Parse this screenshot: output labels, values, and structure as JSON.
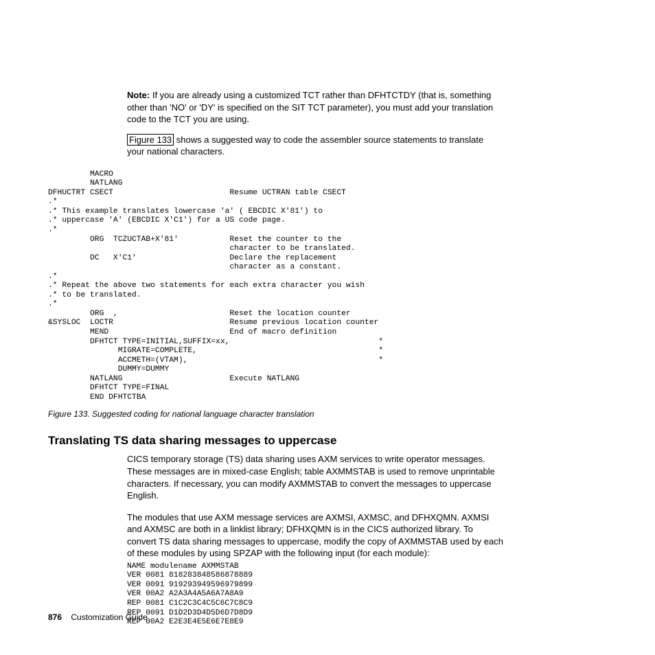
{
  "note": {
    "label": "Note:",
    "text": "If you are already using a customized TCT rather than DFHTCTDY (that is, something other than 'NO' or 'DY' is specified on the SIT TCT parameter), you must add your translation code to the TCT you are using."
  },
  "para1_ref": "Figure 133",
  "para1_rest": " shows a suggested way to code the assembler source statements to translate your national characters.",
  "code1": "         MACRO\n         NATLANG\nDFHUCTRT CSECT                         Resume UCTRAN table CSECT\n.*\n.* This example translates lowercase 'a' ( EBCDIC X'81') to\n.* uppercase 'A' (EBCDIC X'C1') for a US code page.\n.*\n         ORG  TCZUCTAB+X'81'           Reset the counter to the\n                                       character to be translated.\n         DC   X'C1'                    Declare the replacement\n                                       character as a constant.\n.*\n.* Repeat the above two statements for each extra character you wish\n.* to be translated.\n.*\n         ORG  ,                        Reset the location counter\n&SYSLOC  LOCTR                         Resume previous location counter\n         MEND                          End of macro definition\n         DFHTCT TYPE=INITIAL,SUFFIX=xx,                                *\n               MIGRATE=COMPLETE,                                       *\n               ACCMETH=(VTAM),                                         *\n               DUMMY=DUMMY\n         NATLANG                       Execute NATLANG\n         DFHTCT TYPE=FINAL\n         END DFHTCTBA",
  "figcap": "Figure 133. Suggested coding for national language character translation",
  "h2": "Translating TS data sharing messages to uppercase",
  "body1": "CICS temporary storage (TS) data sharing uses AXM services to write operator messages. These messages are in mixed-case English; table AXMMSTAB is used to remove unprintable characters. If necessary, you can modify AXMMSTAB to convert the messages to uppercase English.",
  "body2": "The modules that use AXM message services are AXMSI, AXMSC, and DFHXQMN. AXMSI and AXMSC are both in a linklist library; DFHXQMN is in the CICS authorized library. To convert TS data sharing messages to uppercase, modify the copy of AXMMSTAB used by each of these modules by using SPZAP with the following input (for each module):",
  "code2": "NAME modulename AXMMSTAB\nVER 0081 818283848586878889\nVER 0091 919293949596979899\nVER 00A2 A2A3A4A5A6A7A8A9\nREP 0081 C1C2C3C4C5C6C7C8C9\nREP 0091 D1D2D3D4D5D6D7D8D9\nREP 00A2 E2E3E4E5E6E7E8E9",
  "footer": {
    "page": "876",
    "book": "Customization Guide"
  }
}
